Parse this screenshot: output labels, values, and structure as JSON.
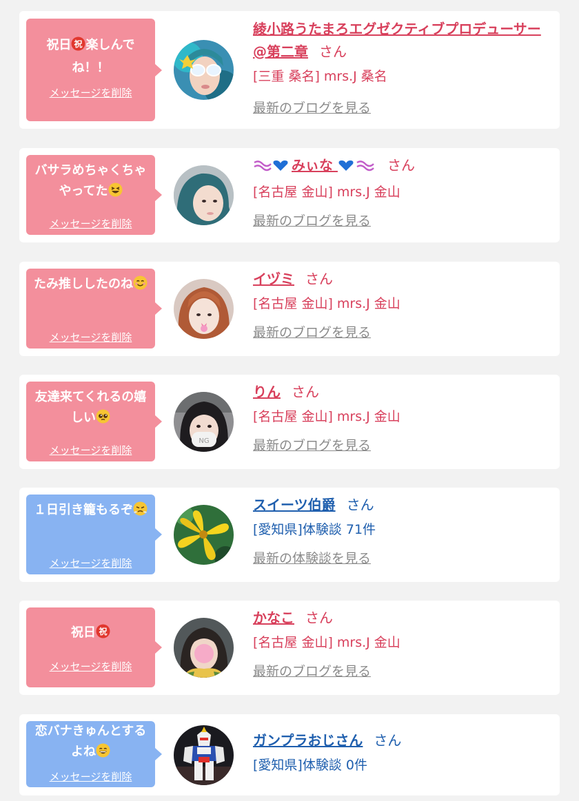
{
  "delete_label": "メッセージを削除",
  "colors": {
    "pink": "#f38f9c",
    "blue": "#88b3f2",
    "name_pink": "#d8405c",
    "name_blue": "#1f5fae",
    "link_gray": "#8b8b8b",
    "background": "#f2f2f2"
  },
  "items": [
    {
      "message": "祝日",
      "message_emoji": "congratulations-emoji",
      "message_rest": "楽しんでね！！",
      "name": "綾小路うたまろエグゼクティブプロデューサー@第二章",
      "honorific": "さん",
      "meta": "[三重 桑名] mrs.J 桑名",
      "link": "最新のブログを見る"
    },
    {
      "message": "バサラめちゃくちゃやってた",
      "message_emoji": "grinning-squinting-face-emoji",
      "name_prefix_emoji": "wave-heart-decoration",
      "name": "みぃな",
      "honorific": "さん",
      "meta": "[名古屋 金山] mrs.J 金山",
      "link": "最新のブログを見る"
    },
    {
      "message": "たみ推ししたのね",
      "message_emoji": "smiling-face-emoji",
      "name": "イヅミ",
      "honorific": "さん",
      "meta": "[名古屋 金山] mrs.J 金山",
      "link": "最新のブログを見る"
    },
    {
      "message": "友達来てくれるの嬉しい",
      "message_emoji": "pleading-face-emoji",
      "name": "りん",
      "honorific": "さん",
      "meta": "[名古屋 金山] mrs.J 金山",
      "link": "最新のブログを見る"
    },
    {
      "message": "１日引き籠もるぞ",
      "message_emoji": "steam-face-emoji",
      "name": "スイーツ伯爵",
      "honorific": "さん",
      "meta": "[愛知県]体験談 71件",
      "link": "最新の体験談を見る"
    },
    {
      "message": "祝日",
      "message_emoji": "congratulations-emoji",
      "name": "かなこ",
      "honorific": "さん",
      "meta": "[名古屋 金山] mrs.J 金山",
      "link": "最新のブログを見る"
    },
    {
      "message": "恋バナきゅんとするよね",
      "message_emoji": "grinning-face-emoji",
      "name": "ガンプラおじさん",
      "honorific": "さん",
      "meta": "[愛知県]体験談 0件"
    }
  ]
}
